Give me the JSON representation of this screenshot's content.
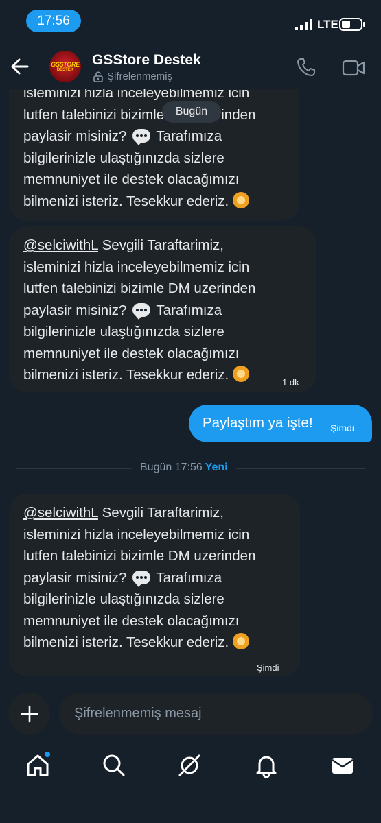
{
  "status_bar": {
    "time": "17:56",
    "network": "LTE"
  },
  "header": {
    "title": "GSStore Destek",
    "subtitle": "Şifrelenmemiş",
    "avatar_line1": "GSSTORE",
    "avatar_line2": "DESTEK"
  },
  "date_pill": "Bugün",
  "messages": [
    {
      "lines": [
        "isleminizi hizla inceleyebilmemiz icin",
        "lutfen talebinizi bizimle DM uzerinden",
        "paylasir misiniz?",
        "Tarafımıza",
        "bilgilerinizle ulaştığınızda sizlere",
        "memnuniyet ile destek olacağımızı",
        "bilmenizi isteriz.  Tesekkur ederiz."
      ],
      "time": ""
    },
    {
      "mention": "@selciwithL",
      "lines": [
        "Sevgili Taraftarimiz,",
        "isleminizi hizla inceleyebilmemiz icin",
        "lutfen talebinizi bizimle DM uzerinden",
        "paylasir misiniz?",
        "Tarafımıza",
        "bilgilerinizle ulaştığınızda sizlere",
        "memnuniyet ile destek olacağımızı",
        "bilmenizi isteriz. Tesekkur ederiz."
      ],
      "time": "1 dk"
    },
    {
      "mention": "@selciwithL",
      "lines": [
        "Sevgili Taraftarimiz,",
        "isleminizi hizla inceleyebilmemiz icin",
        "lutfen talebinizi bizimle DM uzerinden",
        "paylasir misiniz?",
        "Tarafımıza",
        "bilgilerinizle ulaştığınızda sizlere",
        "memnuniyet ile destek olacağımızı",
        "bilmenizi isteriz. Tesekkur ederiz."
      ],
      "time": "Şimdi"
    }
  ],
  "sent": {
    "text": "Paylaştım ya işte!",
    "time": "Şimdi"
  },
  "divider": {
    "label": "Bugün 17:56",
    "new_label": "Yeni"
  },
  "composer": {
    "placeholder": "Şifrelenmemiş mesaj"
  },
  "tabs": [
    "home-icon",
    "search-icon",
    "grok-icon",
    "bell-icon",
    "mail-icon"
  ],
  "colors": {
    "background": "#15202b",
    "accent": "#1d9bf0",
    "bubble": "#1e2328"
  }
}
